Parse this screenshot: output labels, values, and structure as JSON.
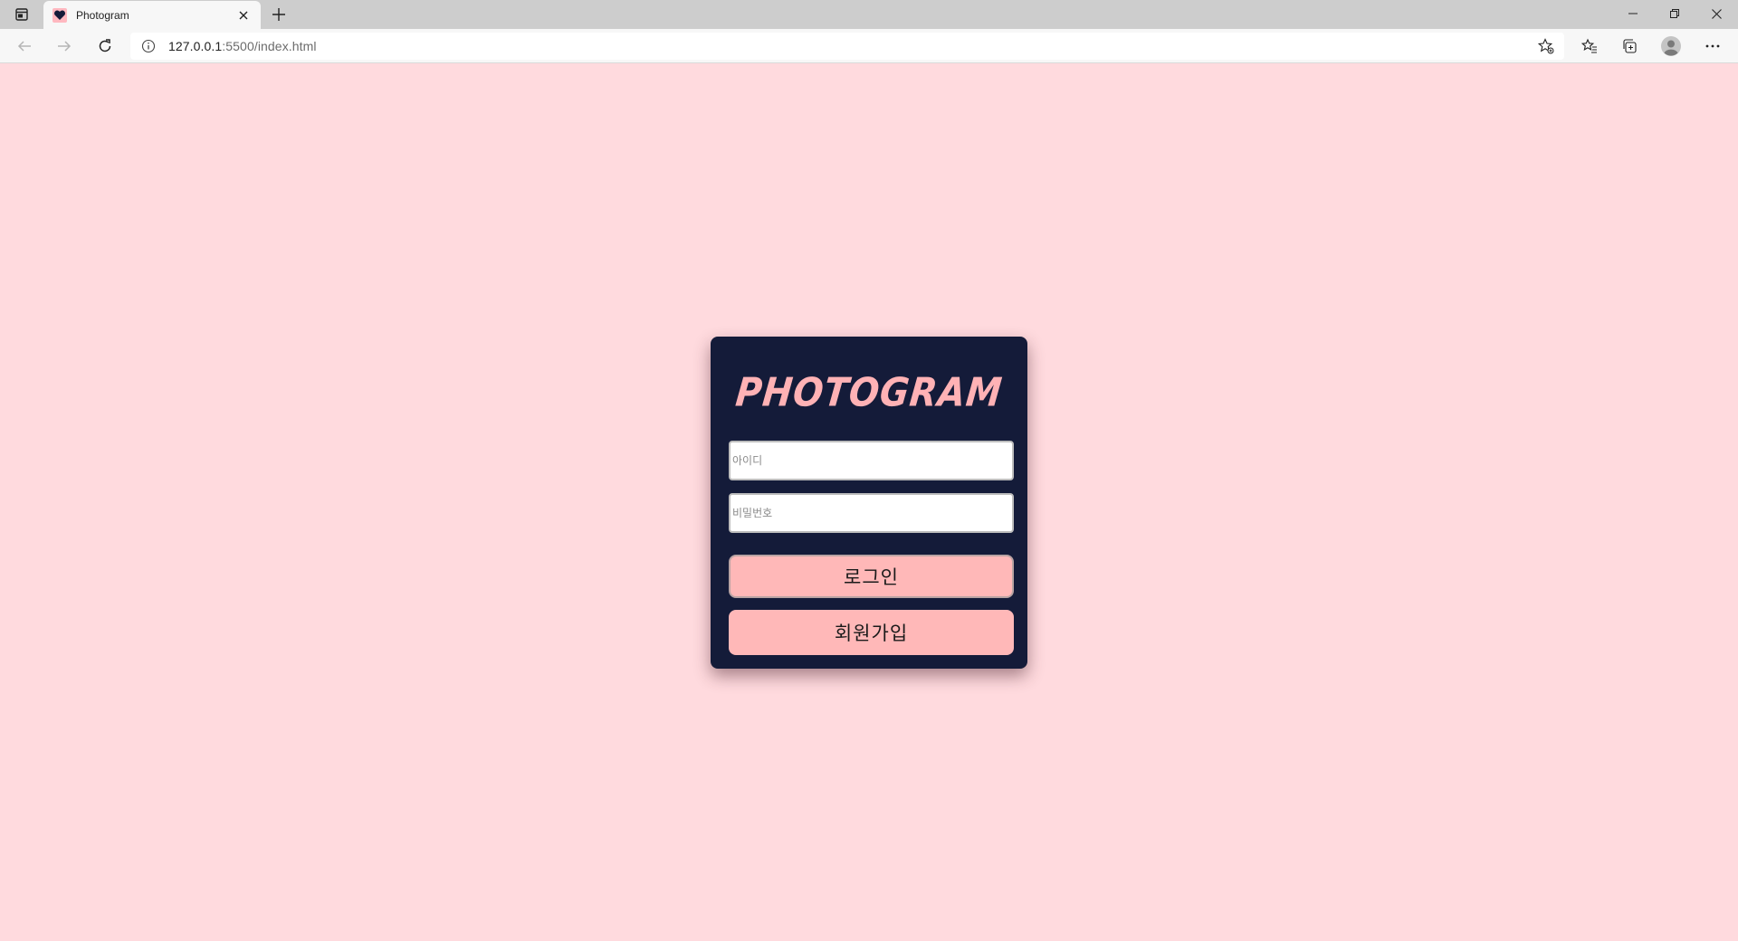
{
  "browser": {
    "tab": {
      "title": "Photogram"
    },
    "address": {
      "url_host": "127.0.0.1",
      "url_rest": ":5500/index.html"
    }
  },
  "page": {
    "logo_text": "PHOTOGRAM",
    "username_placeholder": "아이디",
    "password_placeholder": "비밀번호",
    "login_label": "로그인",
    "signup_label": "회원가입"
  },
  "colors": {
    "page_background": "#ffdade",
    "card_background": "#141b39",
    "accent_pink": "#ffb8b8",
    "logo_pink": "#ffb2b5"
  },
  "icons": {
    "favicon": "heart-icon",
    "logo_mark": "geometric-heart-icon"
  }
}
